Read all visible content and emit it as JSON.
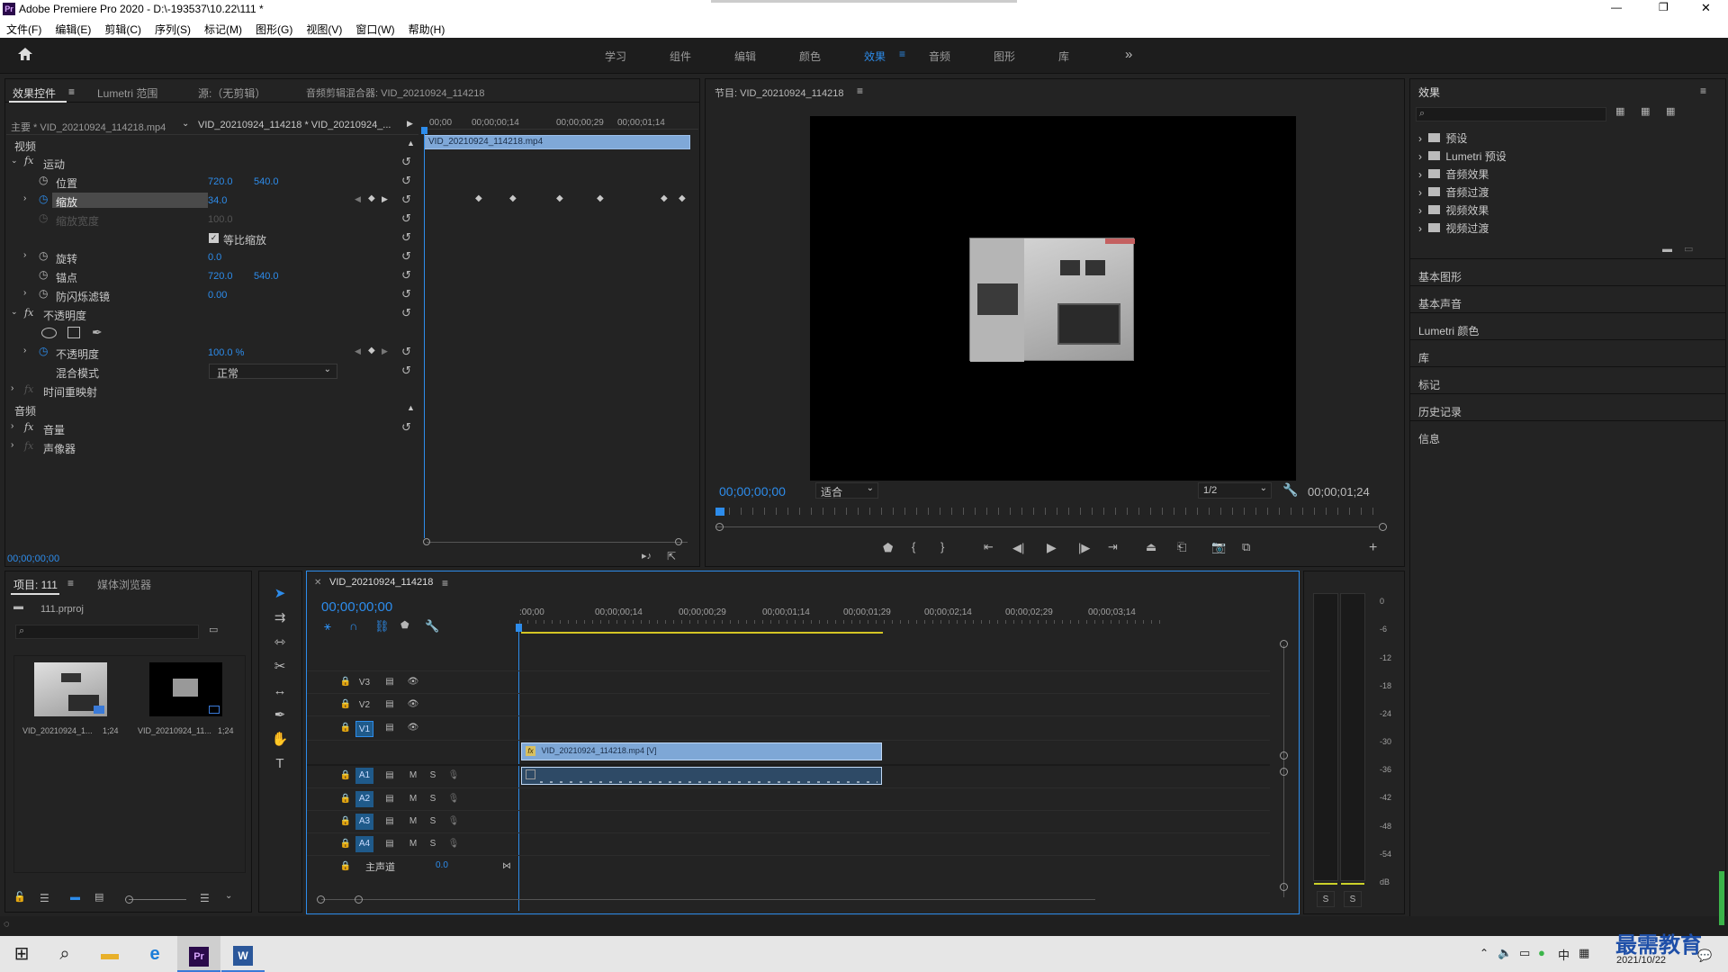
{
  "app": {
    "title": "Adobe Premiere Pro 2020 - D:\\-193537\\10.22\\111 *",
    "logo": "Pr"
  },
  "window_controls": {
    "minimize": "—",
    "maximize": "❐",
    "close": "✕"
  },
  "menu": [
    "文件(F)",
    "编辑(E)",
    "剪辑(C)",
    "序列(S)",
    "标记(M)",
    "图形(G)",
    "视图(V)",
    "窗口(W)",
    "帮助(H)"
  ],
  "workspaces": {
    "items": [
      "学习",
      "组件",
      "编辑",
      "颜色",
      "效果",
      "音频",
      "图形",
      "库"
    ],
    "active": "效果",
    "more": "»"
  },
  "effect_controls": {
    "tabs": [
      "效果控件",
      "Lumetri 范围",
      "源:（无剪辑）",
      "音频剪辑混合器: VID_20210924_114218"
    ],
    "master": "主要 * VID_20210924_114218.mp4",
    "sequence": "VID_20210924_114218 * VID_20210924_...",
    "section_video": "视频",
    "section_audio": "音频",
    "motion": "运动",
    "position_label": "位置",
    "position_x": "720.0",
    "position_y": "540.0",
    "scale_label": "缩放",
    "scale_val": "34.0",
    "scale_width_label": "缩放宽度",
    "scale_width_val": "100.0",
    "uniform_label": "等比缩放",
    "rotation_label": "旋转",
    "rotation_val": "0.0",
    "anchor_label": "锚点",
    "anchor_x": "720.0",
    "anchor_y": "540.0",
    "flicker_label": "防闪烁滤镜",
    "flicker_val": "0.00",
    "opacity_group": "不透明度",
    "opacity_label": "不透明度",
    "opacity_val": "100.0 %",
    "blend_label": "混合模式",
    "blend_val": "正常",
    "time_remap": "时间重映射",
    "volume": "音量",
    "panner": "声像器",
    "timecode": "00;00;00;00",
    "mini_ruler": [
      "00;00",
      "00;00;00;14",
      "00;00;00;29",
      "00;00;01;14"
    ],
    "clip_name": "VID_20210924_114218.mp4"
  },
  "program": {
    "title": "节目: VID_20210924_114218",
    "tc_left": "00;00;00;00",
    "fit": "适合",
    "ratio": "1/2",
    "tc_right": "00;00;01;24"
  },
  "effects_panel": {
    "title": "效果",
    "tree": [
      "预设",
      "Lumetri 预设",
      "音频效果",
      "音频过渡",
      "视频效果",
      "视频过渡"
    ],
    "sections": [
      "基本图形",
      "基本声音",
      "Lumetri 颜色",
      "库",
      "标记",
      "历史记录",
      "信息"
    ]
  },
  "project": {
    "tabs": [
      "项目: 111",
      "媒体浏览器"
    ],
    "file": "111.prproj",
    "items": [
      {
        "name": "VID_20210924_1...",
        "dur": "1;24"
      },
      {
        "name": "VID_20210924_11...",
        "dur": "1;24"
      }
    ]
  },
  "timeline": {
    "title": "VID_20210924_114218",
    "timecode": "00;00;00;00",
    "ruler": [
      ":00;00",
      "00;00;00;14",
      "00;00;00;29",
      "00;00;01;14",
      "00;00;01;29",
      "00;00;02;14",
      "00;00;02;29",
      "00;00;03;14"
    ],
    "video_tracks": [
      "V3",
      "V2",
      "V1"
    ],
    "audio_tracks": [
      "A1",
      "A2",
      "A3",
      "A4"
    ],
    "master": "主声道",
    "master_val": "0.0",
    "clip_v": "VID_20210924_114218.mp4 [V]",
    "m": "M",
    "s": "S"
  },
  "meter": {
    "scale": [
      "0",
      "-6",
      "-12",
      "-18",
      "-24",
      "-30",
      "-36",
      "-42",
      "-48",
      "-54",
      "dB"
    ],
    "solo": [
      "S",
      "S"
    ]
  },
  "taskbar": {
    "ime": "中",
    "date": "2021/10/22",
    "watermark": "最需教育"
  }
}
